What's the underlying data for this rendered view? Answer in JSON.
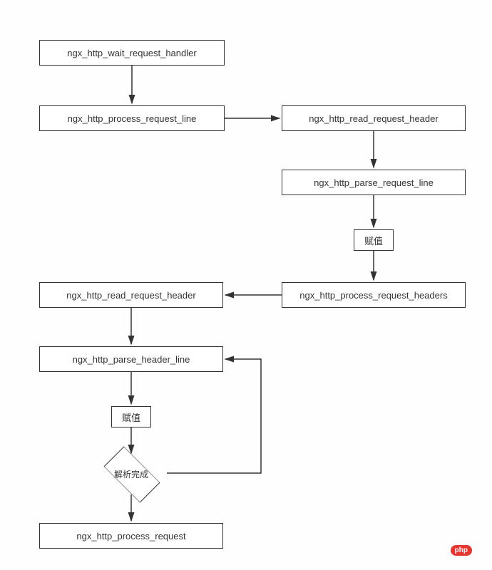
{
  "nodes": {
    "wait_request": "ngx_http_wait_request_handler",
    "process_request_line": "ngx_http_process_request_line",
    "read_request_header_1": "ngx_http_read_request_header",
    "parse_request_line": "ngx_http_parse_request_line",
    "assign_1": "赋值",
    "process_request_headers": "ngx_http_process_request_headers",
    "read_request_header_2": "ngx_http_read_request_header",
    "parse_header_line": "ngx_http_parse_header_line",
    "assign_2": "赋值",
    "parse_done": "解析完成",
    "process_request": "ngx_http_process_request"
  },
  "badge": "php"
}
